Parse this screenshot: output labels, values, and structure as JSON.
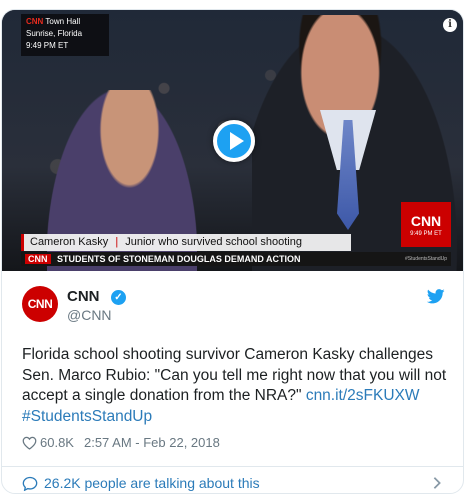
{
  "video": {
    "location_box": {
      "network": "CNN",
      "program": "Town Hall",
      "place": "Sunrise, Florida",
      "time": "9:49 PM ET"
    },
    "lower_third": {
      "name": "Cameron Kasky",
      "description": "Junior who survived school shooting"
    },
    "ticker": {
      "network": "CNN",
      "headline": "STUDENTS OF STONEMAN DOUGLAS DEMAND ACTION",
      "hashtag": "#StudentsStandUp"
    },
    "corner_logo": "CNN",
    "corner_bug": "9:49 PM ET",
    "info_symbol": "i"
  },
  "author": {
    "avatar_text": "CNN",
    "name": "CNN",
    "handle": "@CNN"
  },
  "tweet": {
    "text": "Florida school shooting survivor Cameron Kasky challenges Sen. Marco Rubio: \"Can you tell me right now that you will not accept a single donation from the NRA?\"",
    "link": "cnn.it/2sFKUXW",
    "hashtag": "#StudentsStandUp"
  },
  "meta": {
    "likes": "60.8K",
    "timestamp": "2:57 AM - Feb 22, 2018"
  },
  "footer": {
    "talking": "26.2K people are talking about this"
  },
  "colors": {
    "accent": "#1da1f2",
    "link": "#2b7bb9",
    "cnn_red": "#cc0000",
    "muted": "#697882"
  }
}
